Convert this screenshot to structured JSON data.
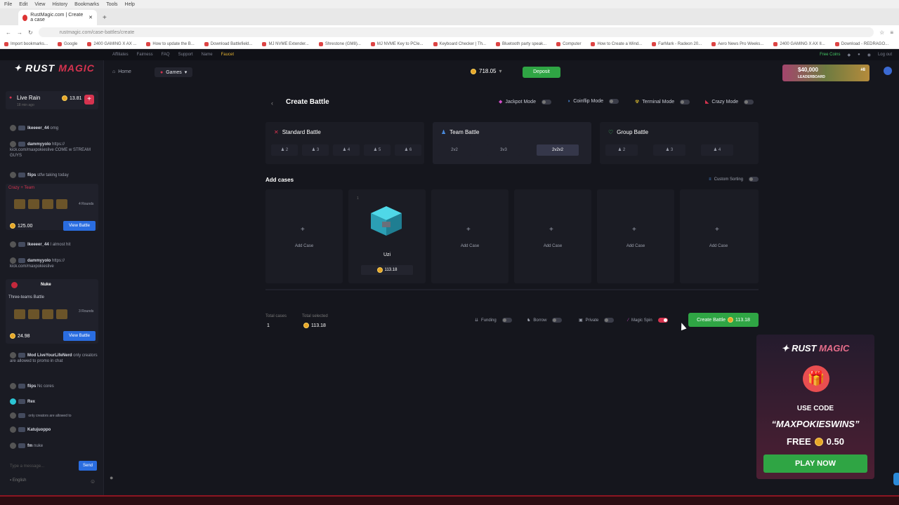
{
  "browser": {
    "menu": [
      "File",
      "Edit",
      "View",
      "History",
      "Bookmarks",
      "Tools",
      "Help"
    ],
    "tab_title": "RustMagic.com | Create a case",
    "url": "rustmagic.com/case-battles/create",
    "bookmarks": [
      "Import bookmarks...",
      "Google",
      "2400 GAMING X AX ...",
      "How to update the B...",
      "Download Battlefield...",
      "MJ NVME Extender...",
      "Shrestone (GM8)...",
      "MJ NVME Key to PCIe...",
      "Keyboard Checker | Th...",
      "Bluetooth party speak...",
      "Computer",
      "How to Create a Wind...",
      "FarMark - Radeon 20...",
      "Aero News Pro Weeks...",
      "2400 GAMING X AX II...",
      "Download - REDRAGO..."
    ]
  },
  "topstrip": {
    "links": [
      "Affiliates",
      "Fairness",
      "FAQ",
      "Support",
      "Name"
    ],
    "faucet": "Faucet",
    "free_coins": "Free Coins",
    "logout": "Log out"
  },
  "brand": {
    "rust": "RUST",
    "magic": "MAGIC"
  },
  "header": {
    "home": "Home",
    "games": "Games",
    "balance": "718.05",
    "deposit": "Deposit",
    "leaderboard_amount": "$40,000",
    "leaderboard_label": "LEADERBOARD",
    "rank": "#8"
  },
  "sidebar": {
    "rain_title": "Live Rain",
    "rain_sub": "18 min ago",
    "rain_amount": "13.81",
    "chat": [
      {
        "user": "lkeeeer_44",
        "text": "omg"
      },
      {
        "user": "dammyyolo",
        "text": "https:// kick.com/maxpokieslive COME w STREAM GUYS"
      },
      {
        "user": "flips",
        "text": "stfw taking today"
      },
      {
        "user": "lkeeeer_44",
        "text": "I almost hit"
      },
      {
        "user": "dammyyolo",
        "text": "https:// kick.com/maxpokieslive"
      },
      {
        "user": "Nuke",
        "text": ""
      },
      {
        "user": "Mod LiveYourLifeNerd",
        "text": "only creators are allowed to promo in chat"
      },
      {
        "user": "flips",
        "text": "Nc cores"
      },
      {
        "user": "Rex",
        "text": ""
      },
      {
        "user": "",
        "text": "only creators are allowed to"
      },
      {
        "user": "Katujuoppo",
        "text": ""
      },
      {
        "user": "fm",
        "text": "nuke"
      }
    ],
    "battle1_mode": "Crazy + Team",
    "battle1_rounds": "4 Rounds",
    "battle1_price": "125.00",
    "battle2_mode": "Three-teams Battle",
    "battle2_rounds": "3 Rounds",
    "battle2_price": "24.98",
    "view_battle": "View Battle",
    "input_placeholder": "Type a message...",
    "send": "Send",
    "language": "English"
  },
  "create": {
    "title": "Create Battle",
    "modes": [
      {
        "label": "Jackpot Mode",
        "on": false
      },
      {
        "label": "Coinflip Mode",
        "on": false
      },
      {
        "label": "Terminal Mode",
        "on": false
      },
      {
        "label": "Crazy Mode",
        "on": false
      }
    ],
    "standard": {
      "title": "Standard Battle",
      "options": [
        "2",
        "3",
        "4",
        "5",
        "6"
      ]
    },
    "team": {
      "title": "Team Battle",
      "options": [
        "2v2",
        "3v3",
        "2v2v2"
      ],
      "selected": 2
    },
    "group": {
      "title": "Group Battle",
      "options": [
        "2",
        "3",
        "4"
      ]
    },
    "add_cases": "Add cases",
    "custom_sorting": "Custom Sorting",
    "add_case": "Add Case",
    "case": {
      "name": "Uzi",
      "price": "113.18",
      "count": "1"
    },
    "total_cases_label": "Total cases",
    "total_cases": "1",
    "total_selected_label": "Total selected",
    "total_selected": "113.18",
    "options": [
      {
        "label": "Funding",
        "on": false
      },
      {
        "label": "Borrow",
        "on": false
      },
      {
        "label": "Private",
        "on": false
      },
      {
        "label": "Magic Spin",
        "on": true
      }
    ],
    "create_button": "Create Battle",
    "create_price": "113.18"
  },
  "promo": {
    "use_code": "USE CODE",
    "code": "“MAXPOKIESWINS”",
    "free": "FREE",
    "amount": "0.50",
    "play": "PLAY NOW"
  },
  "colors": {
    "accent": "#d6334f",
    "green": "#2fa544",
    "blue": "#2a6de0",
    "bg": "#15161d"
  }
}
